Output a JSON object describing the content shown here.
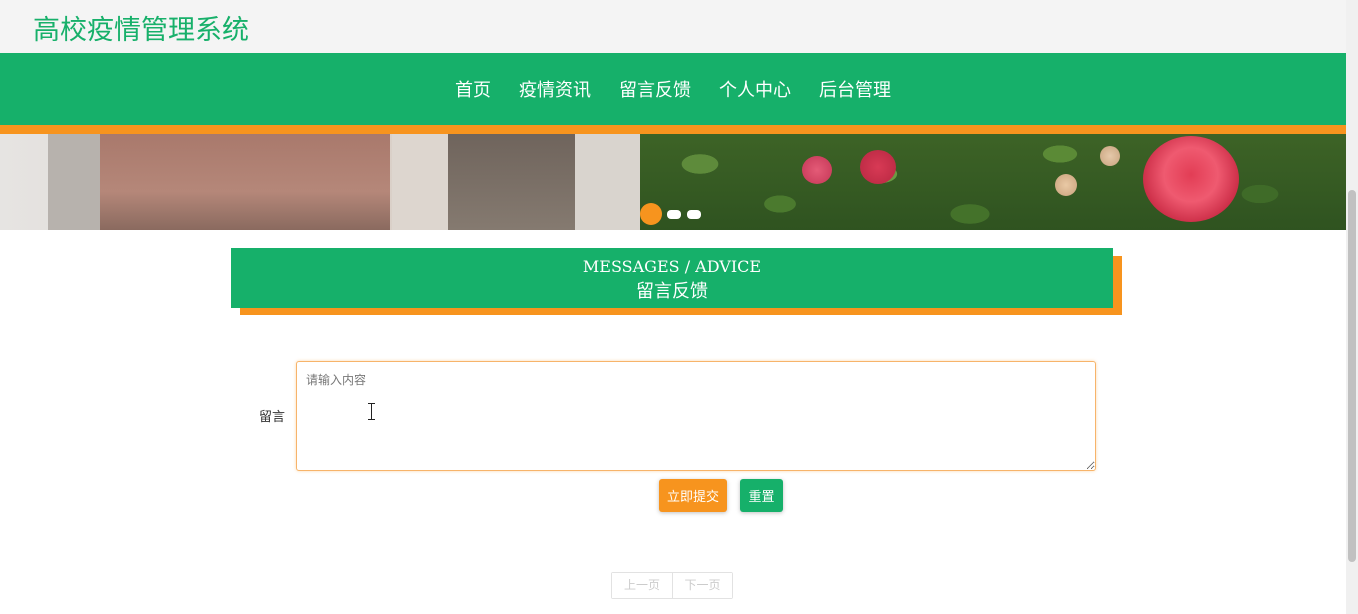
{
  "header": {
    "site_title": "高校疫情管理系统"
  },
  "nav": {
    "items": [
      "首页",
      "疫情资讯",
      "留言反馈",
      "个人中心",
      "后台管理"
    ]
  },
  "banner": {
    "slides": 3,
    "active_slide": 1
  },
  "section": {
    "title_en": "MESSAGES / ADVICE",
    "title_cn": "留言反馈"
  },
  "form": {
    "message_label": "留言",
    "message_placeholder": "请输入内容",
    "message_value": "",
    "submit_label": "立即提交",
    "reset_label": "重置"
  },
  "pager": {
    "prev_label": "上一页",
    "next_label": "下一页"
  },
  "colors": {
    "brand_green": "#16b06a",
    "accent_orange": "#f7941e"
  }
}
